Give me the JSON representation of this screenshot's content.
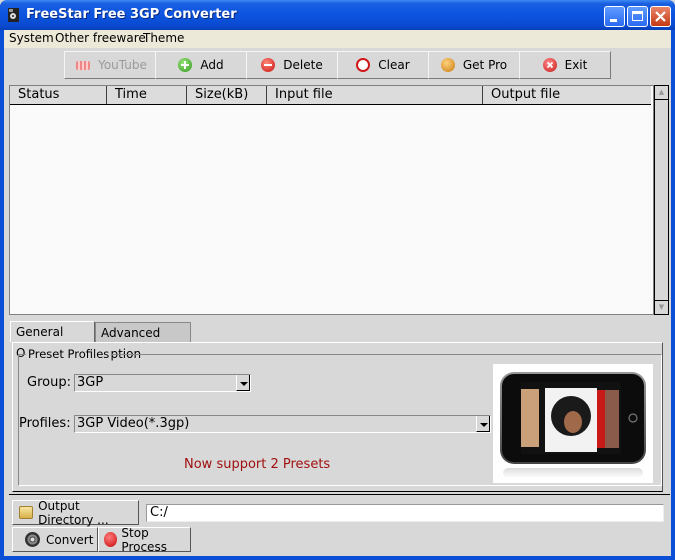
{
  "window": {
    "title": "FreeStar Free 3GP Converter"
  },
  "menu": [
    "System",
    "Other freeware",
    "Theme"
  ],
  "toolbar": {
    "youtube": "YouTube",
    "add": "Add",
    "delete": "Delete",
    "clear": "Clear",
    "get_pro": "Get Pro",
    "exit": "Exit"
  },
  "table": {
    "columns": [
      "Status",
      "Time",
      "Size(kB)",
      "Input file",
      "Output file"
    ],
    "rows": []
  },
  "tabs": [
    "General Option",
    "Advanced Option"
  ],
  "preset": {
    "group_title": "Preset Profiles",
    "group_label": "Group:",
    "group_value": "3GP",
    "profiles_label": "Profiles:",
    "profiles_value": "3GP Video(*.3gp)",
    "notice": "Now support 2 Presets",
    "notice_color": "#a01010"
  },
  "output": {
    "dir_button": "Output Directory ...",
    "path": "C:/"
  },
  "actions": {
    "convert": "Convert",
    "stop": "Stop Process"
  }
}
